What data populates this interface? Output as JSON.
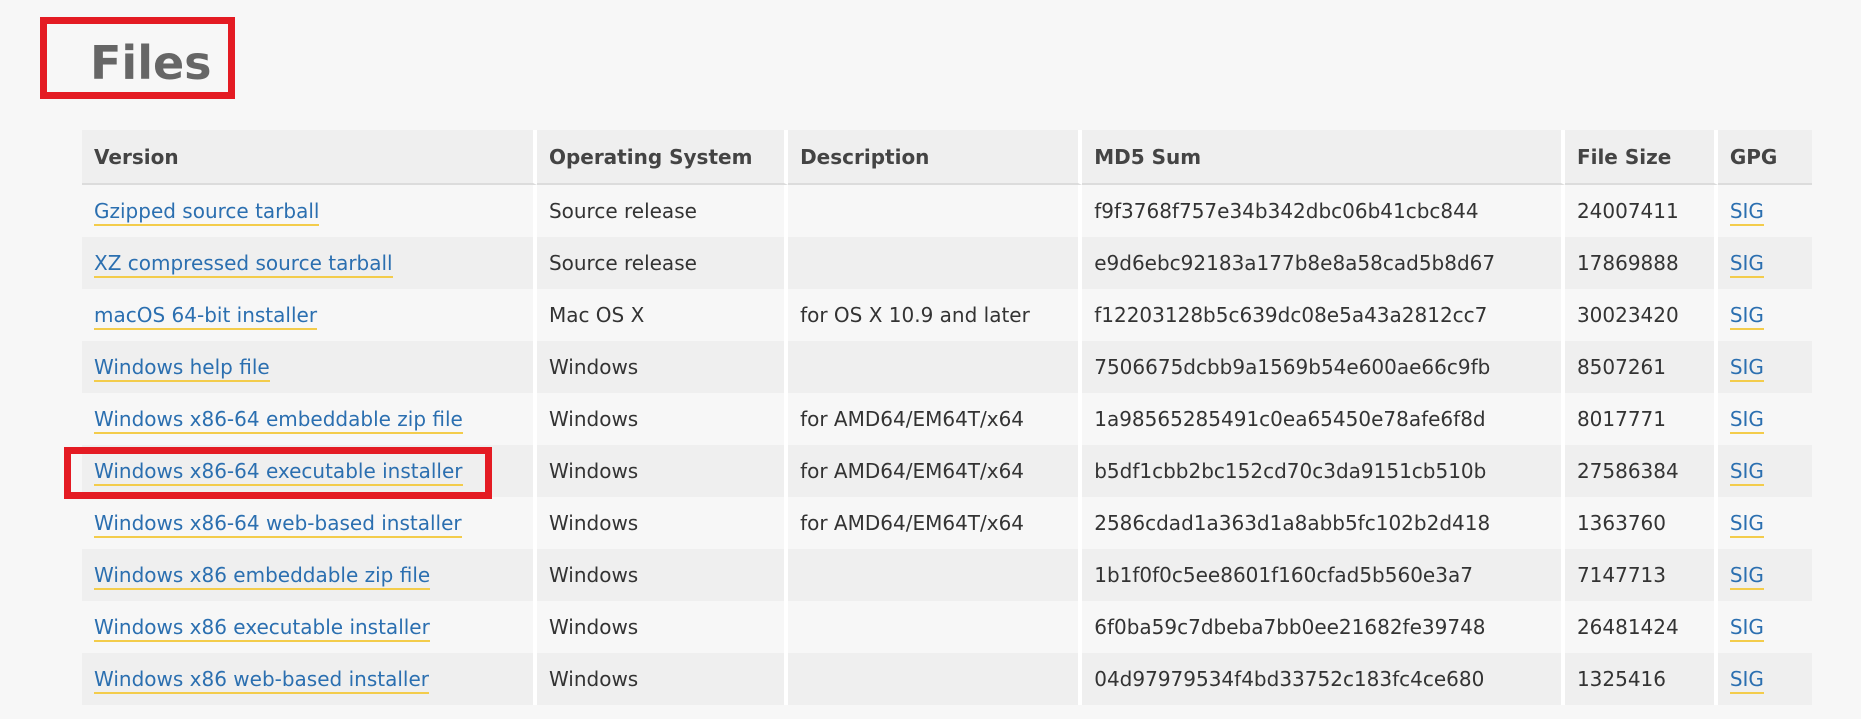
{
  "page": {
    "heading": "Files"
  },
  "table": {
    "headers": {
      "version": "Version",
      "os": "Operating System",
      "description": "Description",
      "md5": "MD5 Sum",
      "size": "File Size",
      "gpg": "GPG"
    },
    "rows": [
      {
        "version": "Gzipped source tarball",
        "os": "Source release",
        "description": "",
        "md5": "f9f3768f757e34b342dbc06b41cbc844",
        "size": "24007411",
        "gpg": "SIG"
      },
      {
        "version": "XZ compressed source tarball",
        "os": "Source release",
        "description": "",
        "md5": "e9d6ebc92183a177b8e8a58cad5b8d67",
        "size": "17869888",
        "gpg": "SIG"
      },
      {
        "version": "macOS 64-bit installer",
        "os": "Mac OS X",
        "description": "for OS X 10.9 and later",
        "md5": "f12203128b5c639dc08e5a43a2812cc7",
        "size": "30023420",
        "gpg": "SIG"
      },
      {
        "version": "Windows help file",
        "os": "Windows",
        "description": "",
        "md5": "7506675dcbb9a1569b54e600ae66c9fb",
        "size": "8507261",
        "gpg": "SIG"
      },
      {
        "version": "Windows x86-64 embeddable zip file",
        "os": "Windows",
        "description": "for AMD64/EM64T/x64",
        "md5": "1a98565285491c0ea65450e78afe6f8d",
        "size": "8017771",
        "gpg": "SIG"
      },
      {
        "version": "Windows x86-64 executable installer",
        "os": "Windows",
        "description": "for AMD64/EM64T/x64",
        "md5": "b5df1cbb2bc152cd70c3da9151cb510b",
        "size": "27586384",
        "gpg": "SIG"
      },
      {
        "version": "Windows x86-64 web-based installer",
        "os": "Windows",
        "description": "for AMD64/EM64T/x64",
        "md5": "2586cdad1a363d1a8abb5fc102b2d418",
        "size": "1363760",
        "gpg": "SIG"
      },
      {
        "version": "Windows x86 embeddable zip file",
        "os": "Windows",
        "description": "",
        "md5": "1b1f0f0c5ee8601f160cfad5b560e3a7",
        "size": "7147713",
        "gpg": "SIG"
      },
      {
        "version": "Windows x86 executable installer",
        "os": "Windows",
        "description": "",
        "md5": "6f0ba59c7dbeba7bb0ee21682fe39748",
        "size": "26481424",
        "gpg": "SIG"
      },
      {
        "version": "Windows x86 web-based installer",
        "os": "Windows",
        "description": "",
        "md5": "04d97979534f4bd33752c183fc4ce680",
        "size": "1325416",
        "gpg": "SIG"
      }
    ]
  },
  "colors": {
    "annotation_border": "#e41b23",
    "link": "#2b6fb0",
    "link_underline": "#f3cc4b",
    "heading": "#666666"
  }
}
